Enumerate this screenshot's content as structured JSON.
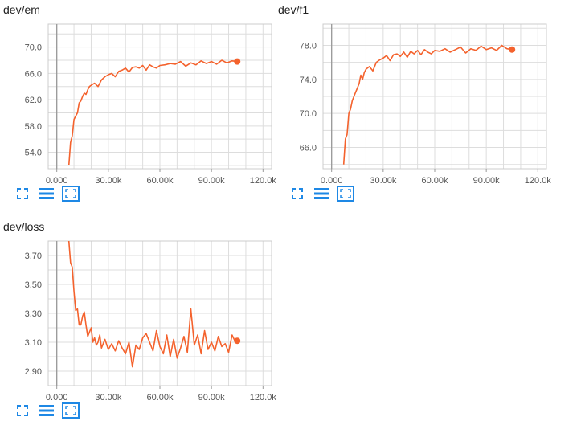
{
  "colors": {
    "series": "#f4622d",
    "icon": "#1e88e5"
  },
  "toolbar_icons": [
    "fit-domain-icon",
    "toggle-log-icon",
    "expand-icon"
  ],
  "charts": [
    {
      "title": "dev/em"
    },
    {
      "title": "dev/f1"
    },
    {
      "title": "dev/loss"
    }
  ],
  "chart_data": [
    {
      "type": "line",
      "title": "dev/em",
      "xlim": [
        -5000,
        125000
      ],
      "ylim": [
        51.5,
        73.5
      ],
      "xticks": [
        0,
        30000,
        60000,
        90000,
        120000
      ],
      "xtick_labels": [
        "0.000",
        "30.00k",
        "60.00k",
        "90.00k",
        "120.0k"
      ],
      "yticks": [
        54,
        58,
        62,
        66,
        70
      ],
      "ytick_labels": [
        "54.0",
        "58.0",
        "62.0",
        "66.0",
        "70.0"
      ],
      "grid": true,
      "series": [
        {
          "x": [
            7000,
            8000,
            9000,
            10000,
            11000,
            12000,
            13000,
            14000,
            15000,
            16000,
            17000,
            18000,
            19000,
            20000,
            22000,
            24000,
            26000,
            28000,
            30000,
            32000,
            34000,
            36000,
            38000,
            40000,
            42000,
            44000,
            46000,
            48000,
            50000,
            52000,
            54000,
            56000,
            58000,
            60000,
            63000,
            66000,
            69000,
            72000,
            75000,
            78000,
            81000,
            84000,
            87000,
            90000,
            93000,
            96000,
            99000,
            102000,
            105000
          ],
          "y": [
            52,
            55.5,
            56.5,
            59,
            59.5,
            60,
            61.5,
            61.8,
            62.5,
            63,
            62.8,
            63.5,
            64,
            64.2,
            64.5,
            64,
            65,
            65.5,
            65.8,
            66,
            65.5,
            66.3,
            66.5,
            66.8,
            66.2,
            66.9,
            67,
            66.8,
            67.2,
            66.5,
            67.3,
            67,
            66.8,
            67.2,
            67.3,
            67.5,
            67.4,
            67.8,
            67.1,
            67.6,
            67.3,
            67.9,
            67.5,
            67.8,
            67.4,
            68,
            67.6,
            67.9,
            67.8
          ]
        }
      ]
    },
    {
      "type": "line",
      "title": "dev/f1",
      "xlim": [
        -5000,
        125000
      ],
      "ylim": [
        63.5,
        80.5
      ],
      "xticks": [
        0,
        30000,
        60000,
        90000,
        120000
      ],
      "xtick_labels": [
        "0.000",
        "30.00k",
        "60.00k",
        "90.00k",
        "120.0k"
      ],
      "yticks": [
        66,
        70,
        74,
        78
      ],
      "ytick_labels": [
        "66.0",
        "70.0",
        "74.0",
        "78.0"
      ],
      "grid": true,
      "series": [
        {
          "x": [
            7000,
            8000,
            9000,
            10000,
            11000,
            12000,
            13000,
            14000,
            15000,
            16000,
            17000,
            18000,
            19000,
            20000,
            22000,
            24000,
            26000,
            28000,
            30000,
            32000,
            34000,
            36000,
            38000,
            40000,
            42000,
            44000,
            46000,
            48000,
            50000,
            52000,
            54000,
            56000,
            58000,
            60000,
            63000,
            66000,
            69000,
            72000,
            75000,
            78000,
            81000,
            84000,
            87000,
            90000,
            93000,
            96000,
            99000,
            102000,
            105000
          ],
          "y": [
            64,
            67,
            67.5,
            70,
            70.5,
            71.5,
            72,
            72.5,
            73,
            73.5,
            74.5,
            74,
            74.8,
            75.2,
            75.5,
            75,
            76,
            76.3,
            76.5,
            76.8,
            76.2,
            76.9,
            77,
            76.7,
            77.2,
            76.6,
            77.3,
            77,
            77.4,
            76.9,
            77.5,
            77.2,
            77,
            77.4,
            77.3,
            77.6,
            77.2,
            77.5,
            77.8,
            77.1,
            77.6,
            77.4,
            77.9,
            77.5,
            77.7,
            77.4,
            78,
            77.6,
            77.5
          ]
        }
      ]
    },
    {
      "type": "line",
      "title": "dev/loss",
      "xlim": [
        -5000,
        125000
      ],
      "ylim": [
        2.8,
        3.8
      ],
      "xticks": [
        0,
        30000,
        60000,
        90000,
        120000
      ],
      "xtick_labels": [
        "0.000",
        "30.00k",
        "60.00k",
        "90.00k",
        "120.0k"
      ],
      "yticks": [
        2.9,
        3.1,
        3.3,
        3.5,
        3.7
      ],
      "ytick_labels": [
        "2.90",
        "3.10",
        "3.30",
        "3.50",
        "3.70"
      ],
      "grid": true,
      "series": [
        {
          "x": [
            7000,
            8000,
            9000,
            10000,
            11000,
            12000,
            13000,
            14000,
            15000,
            16000,
            17000,
            18000,
            19000,
            20000,
            21000,
            22000,
            23000,
            24000,
            25000,
            26000,
            28000,
            30000,
            32000,
            34000,
            36000,
            38000,
            40000,
            42000,
            44000,
            46000,
            48000,
            50000,
            52000,
            54000,
            56000,
            58000,
            60000,
            62000,
            64000,
            66000,
            68000,
            70000,
            72000,
            74000,
            76000,
            78000,
            80000,
            82000,
            84000,
            86000,
            88000,
            90000,
            92000,
            94000,
            96000,
            98000,
            100000,
            102000,
            104000,
            105000
          ],
          "y": [
            3.8,
            3.65,
            3.62,
            3.45,
            3.32,
            3.33,
            3.22,
            3.22,
            3.28,
            3.31,
            3.22,
            3.14,
            3.17,
            3.2,
            3.1,
            3.13,
            3.08,
            3.1,
            3.15,
            3.06,
            3.12,
            3.05,
            3.09,
            3.04,
            3.11,
            3.06,
            3.02,
            3.1,
            2.93,
            3.08,
            3.05,
            3.13,
            3.16,
            3.1,
            3.04,
            3.18,
            3.07,
            3.02,
            3.15,
            3.0,
            3.12,
            2.99,
            3.06,
            3.14,
            3.03,
            3.33,
            3.08,
            3.15,
            3.02,
            3.18,
            3.05,
            3.1,
            3.04,
            3.14,
            3.07,
            3.09,
            3.03,
            3.15,
            3.1,
            3.11
          ]
        }
      ]
    }
  ]
}
